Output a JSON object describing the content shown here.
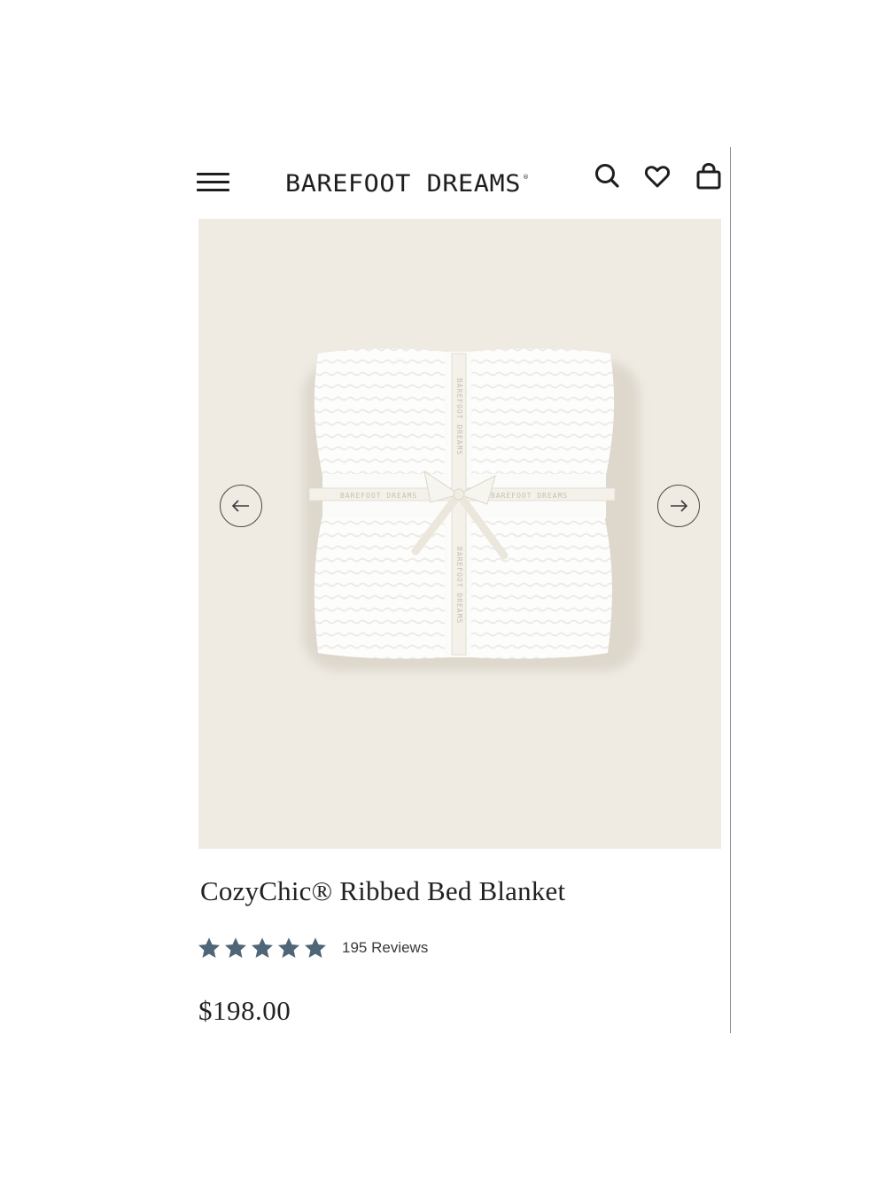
{
  "header": {
    "brand": "BAREFOOT DREAMS",
    "menu_icon": "hamburger-menu-icon",
    "search_icon": "search-icon",
    "wishlist_icon": "heart-icon",
    "cart_icon": "shopping-bag-icon"
  },
  "gallery": {
    "prev_icon": "arrow-left-icon",
    "next_icon": "arrow-right-icon",
    "ribbon_text": "BAREFOOT DREAMS",
    "background_color": "#efebe3"
  },
  "product": {
    "title": "CozyChic® Ribbed Bed Blanket",
    "rating": 5,
    "rating_max": 5,
    "reviews_label": "195 Reviews",
    "price": "$198.00"
  },
  "colors": {
    "star": "#4f6678",
    "text": "#222222"
  }
}
